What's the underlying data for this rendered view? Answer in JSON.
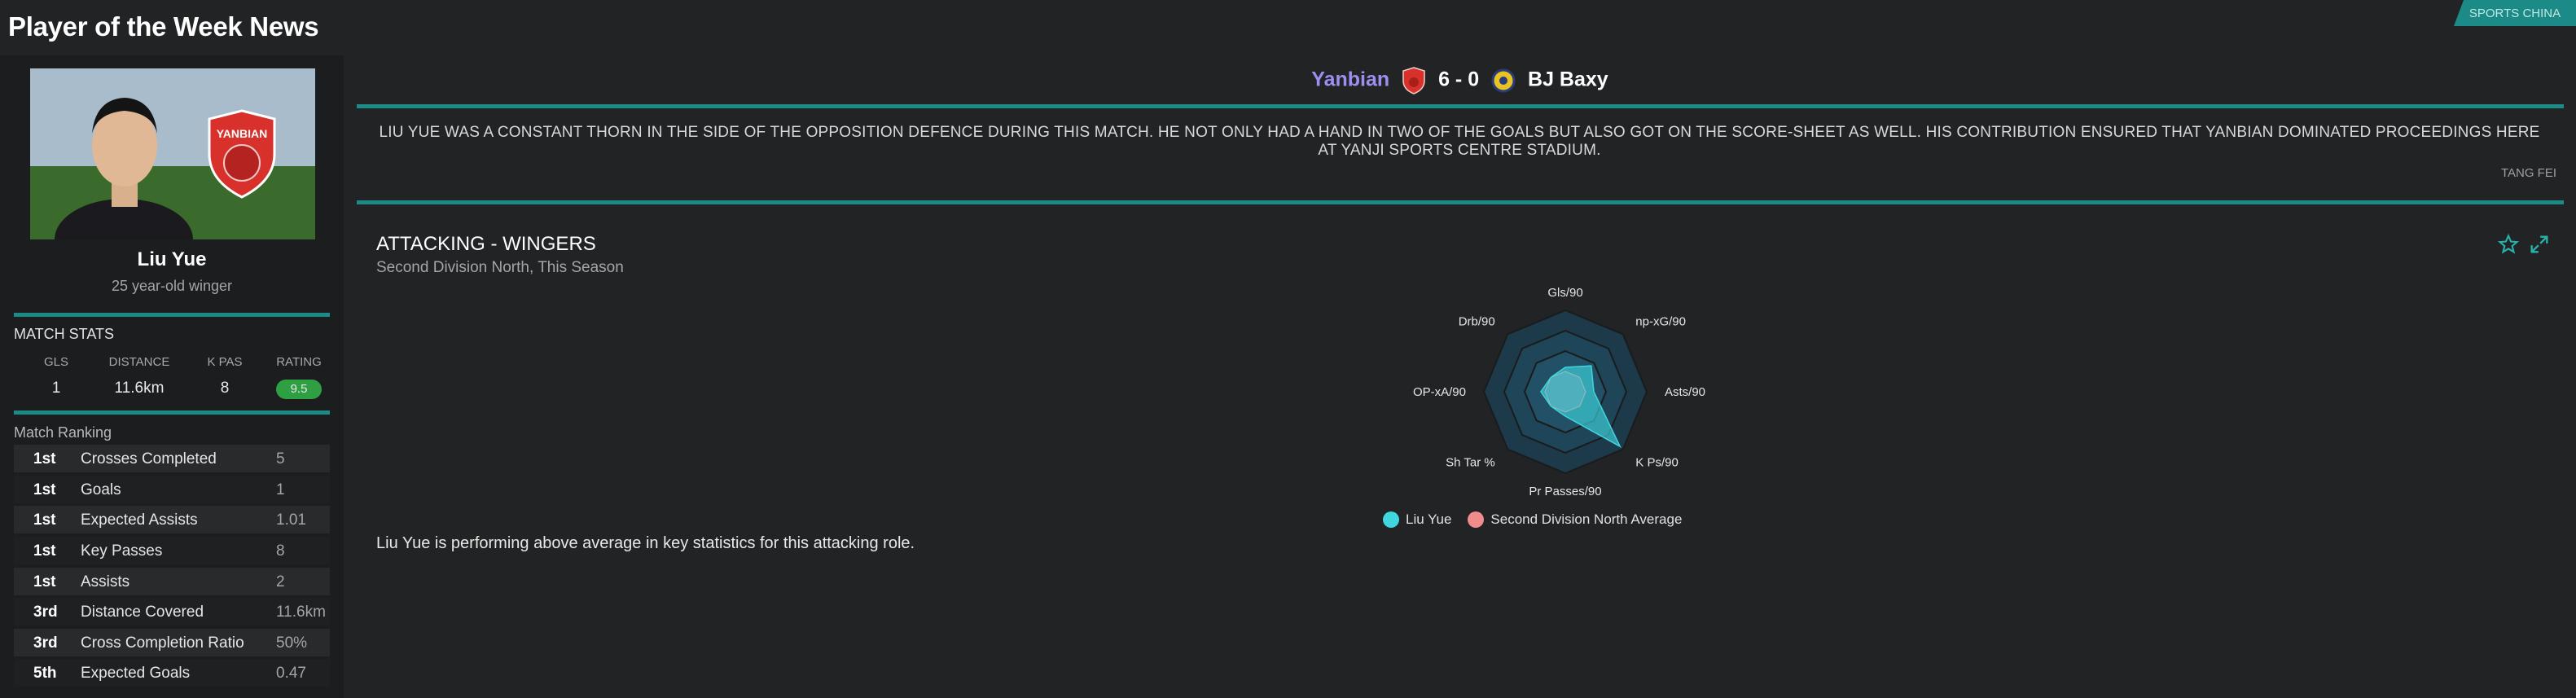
{
  "page_title": "Player of the Week News",
  "corner_badge": "SPORTS CHINA",
  "player": {
    "name": "Liu Yue",
    "description": "25 year-old winger",
    "club_badge_text": "YANBIAN"
  },
  "match_stats": {
    "label": "MATCH STATS",
    "headers": [
      "GLS",
      "DISTANCE",
      "K PAS",
      "RATING"
    ],
    "values": {
      "gls": "1",
      "distance": "11.6km",
      "k_pas": "8",
      "rating": "9.5"
    }
  },
  "match_ranking": {
    "label": "Match Ranking",
    "rows": [
      {
        "pos": "1st",
        "stat": "Crosses Completed",
        "value": "5"
      },
      {
        "pos": "1st",
        "stat": "Goals",
        "value": "1"
      },
      {
        "pos": "1st",
        "stat": "Expected Assists",
        "value": "1.01"
      },
      {
        "pos": "1st",
        "stat": "Key Passes",
        "value": "8"
      },
      {
        "pos": "1st",
        "stat": "Assists",
        "value": "2"
      },
      {
        "pos": "3rd",
        "stat": "Distance Covered",
        "value": "11.6km"
      },
      {
        "pos": "3rd",
        "stat": "Cross Completion Ratio",
        "value": "50%"
      },
      {
        "pos": "5th",
        "stat": "Expected Goals",
        "value": "0.47"
      }
    ]
  },
  "match": {
    "home": "Yanbian",
    "score": "6 - 0",
    "away": "BJ Baxy"
  },
  "story": {
    "text": "LIU YUE WAS A CONSTANT THORN IN THE SIDE OF THE OPPOSITION DEFENCE DURING THIS MATCH. HE NOT ONLY HAD A HAND IN TWO OF THE GOALS BUT ALSO GOT ON THE SCORE-SHEET AS WELL. HIS CONTRIBUTION ENSURED THAT YANBIAN DOMINATED PROCEEDINGS HERE AT YANJI SPORTS CENTRE STADIUM.",
    "byline": "TANG FEI"
  },
  "panel": {
    "title": "ATTACKING - WINGERS",
    "subtitle": "Second Division North, This Season",
    "summary": "Liu Yue is performing above average in key statistics for this attacking role.",
    "icons": [
      "star-icon",
      "expand-icon"
    ]
  },
  "colors": {
    "accent": "#1c8a86",
    "player_series": "#3fd6df",
    "average_series": "#f08c8c",
    "home_team": "#9b8ff0",
    "rating_good": "#2ea043"
  },
  "chart_data": {
    "type": "radar",
    "axes": [
      "Gls/90",
      "np-xG/90",
      "Asts/90",
      "K Ps/90",
      "Pr Passes/90",
      "Sh Tar %",
      "OP-xA/90",
      "Drb/90"
    ],
    "series": [
      {
        "name": "Liu Yue",
        "values": [
          0.3,
          0.45,
          0.35,
          0.95,
          0.3,
          0.25,
          0.3,
          0.25
        ]
      },
      {
        "name": "Second Division North Average",
        "values": [
          0.25,
          0.25,
          0.25,
          0.25,
          0.25,
          0.25,
          0.25,
          0.25
        ]
      }
    ],
    "rings": 4,
    "legend_position": "bottom"
  }
}
